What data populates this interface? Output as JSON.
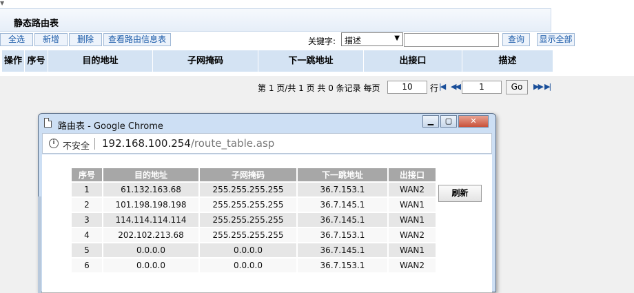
{
  "page": {
    "title": "静态路由表",
    "toolbar": {
      "buttons": [
        "全选",
        "新增",
        "删除",
        "查看路由信息表"
      ],
      "keyword_label": "关键字:",
      "keyword_select": "描述",
      "keyword_input": "",
      "search_label": "查询",
      "show_all_label": "显示全部"
    },
    "columns": [
      "操作",
      "序号",
      "目的地址",
      "子网掩码",
      "下一跳地址",
      "出接口",
      "描述"
    ],
    "pager": {
      "summary": "第 1 页/共 1 页 共 0 条记录 每页",
      "per_page": "10",
      "row_unit": "行",
      "page_input": "1",
      "go_label": "Go"
    }
  },
  "popup": {
    "title": "路由表 - Google Chrome",
    "insecure_label": "不安全",
    "url_host": "192.168.100.254",
    "url_path": "/route_table.asp",
    "table": {
      "headers": [
        "序号",
        "目的地址",
        "子网掩码",
        "下一跳地址",
        "出接口"
      ],
      "rows": [
        [
          "1",
          "61.132.163.68",
          "255.255.255.255",
          "36.7.153.1",
          "WAN2"
        ],
        [
          "2",
          "101.198.198.198",
          "255.255.255.255",
          "36.7.145.1",
          "WAN1"
        ],
        [
          "3",
          "114.114.114.114",
          "255.255.255.255",
          "36.7.145.1",
          "WAN1"
        ],
        [
          "4",
          "202.102.213.68",
          "255.255.255.255",
          "36.7.153.1",
          "WAN2"
        ],
        [
          "5",
          "0.0.0.0",
          "0.0.0.0",
          "36.7.145.1",
          "WAN1"
        ],
        [
          "6",
          "0.0.0.0",
          "0.0.0.0",
          "36.7.153.1",
          "WAN2"
        ]
      ]
    },
    "refresh_label": "刷新"
  }
}
